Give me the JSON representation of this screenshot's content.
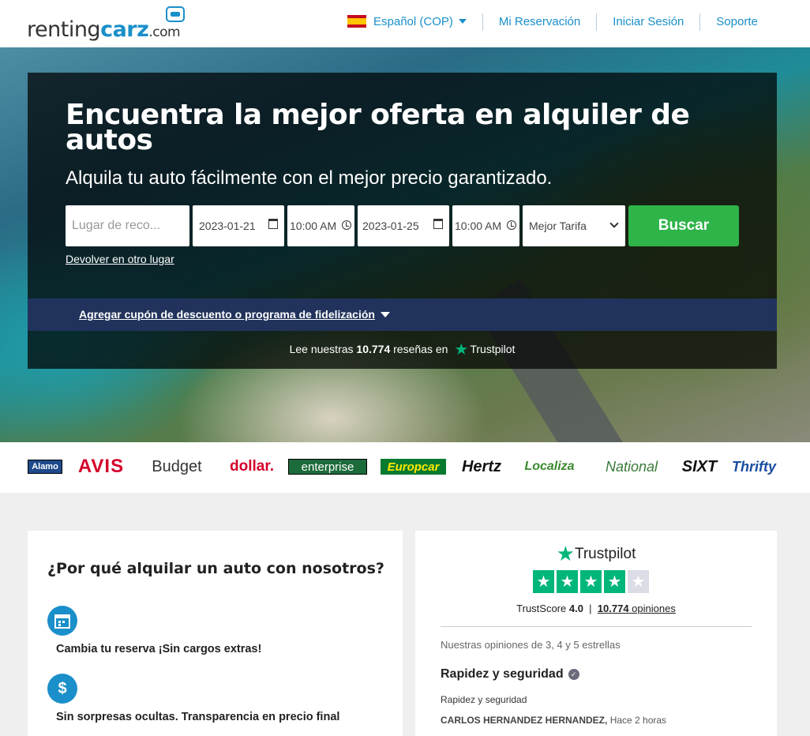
{
  "header": {
    "logo": {
      "part1": "renting",
      "part2": "carz",
      "part3": ".com"
    },
    "nav": {
      "language": "Español (COP)",
      "reservation": "Mi Reservación",
      "login": "Iniciar Sesión",
      "support": "Soporte"
    }
  },
  "hero": {
    "title": "Encuentra la mejor oferta en alquiler de autos",
    "subtitle": "Alquila tu auto fácilmente con el mejor precio garantizado.",
    "search": {
      "pickup_placeholder": "Lugar de reco...",
      "pickup_date": "2023-01-21",
      "pickup_time": "10:00 AM",
      "return_date": "2023-01-25",
      "return_time": "10:00 AM",
      "rate_select": "Mejor Tarifa",
      "submit_label": "Buscar"
    },
    "return_other_link": "Devolver en otro lugar",
    "coupon_link": "Agregar cupón de descuento o programa de fidelización",
    "trustpilot": {
      "prefix": "Lee nuestras",
      "count": "10.774",
      "middle": "reseñas en",
      "brand": "Trustpilot"
    }
  },
  "brands": [
    "Alamo",
    "AVIS",
    "Budget",
    "dollar.",
    "enterprise",
    "Europcar",
    "Hertz",
    "Localiza",
    "National",
    "SIXT",
    "Thrifty"
  ],
  "why": {
    "title": "¿Por qué alquilar un auto con nosotros?",
    "items": [
      {
        "icon": "calendar-icon",
        "text": "Cambia tu reserva ¡Sin cargos extras!"
      },
      {
        "icon": "dollar-icon",
        "text": "Sin sorpresas ocultas. Transparencia en precio final"
      }
    ]
  },
  "trustpilot_card": {
    "brand": "Trustpilot",
    "rating_stars": 4,
    "score_label": "TrustScore",
    "score": "4.0",
    "reviews_count": "10.774",
    "reviews_label": "opiniones",
    "caption": "Nuestras opiniones de 3, 4 y 5 estrellas",
    "review": {
      "title": "Rapidez y seguridad",
      "body": "Rapidez y seguridad",
      "author": "CARLOS HERNANDEZ HERNANDEZ,",
      "time": "Hace 2 horas"
    }
  },
  "colors": {
    "accent": "#1a8fc9",
    "green": "#2fb44a",
    "navy": "#21335c",
    "trustpilot": "#00b67a"
  }
}
